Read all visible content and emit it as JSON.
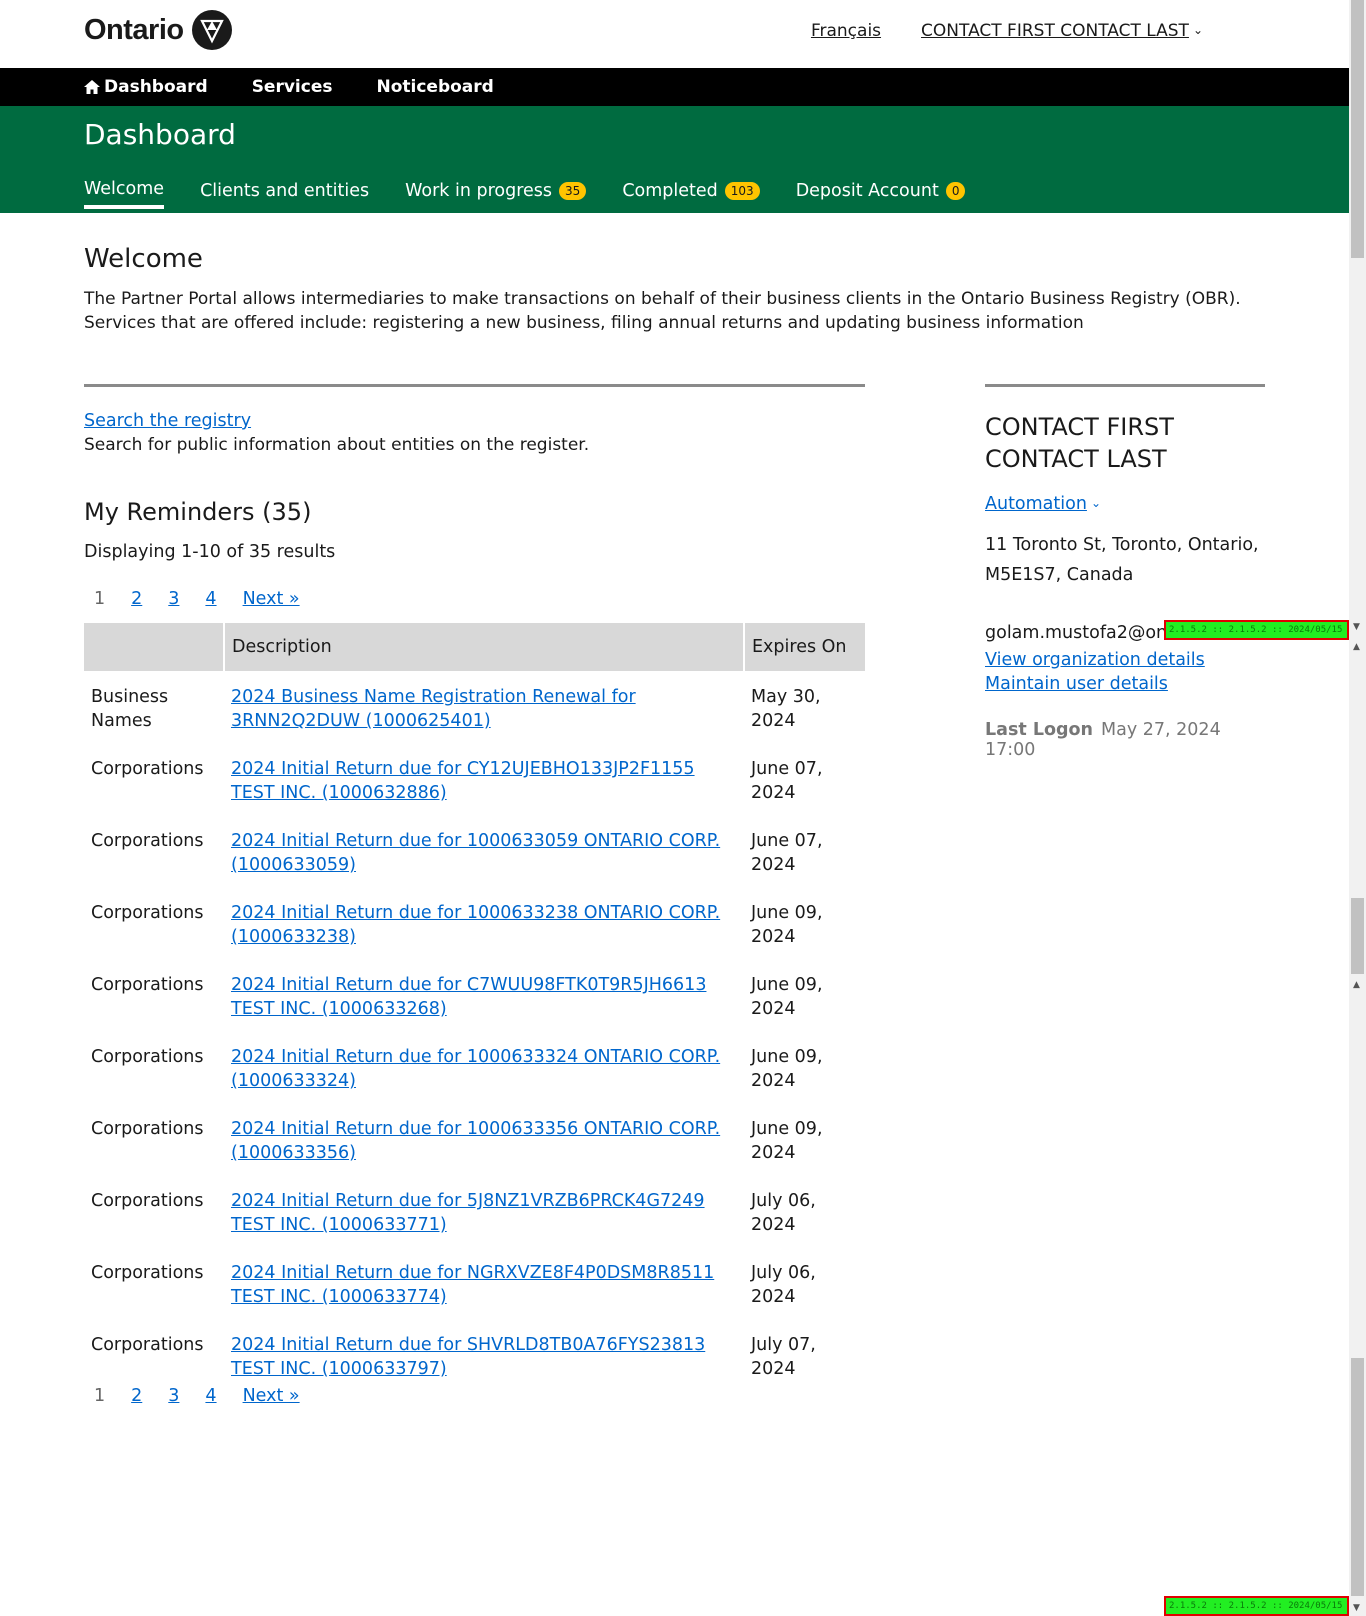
{
  "header": {
    "logo_text": "Ontario",
    "language_link": "Français",
    "user_menu": "CONTACT FIRST CONTACT LAST"
  },
  "topnav": {
    "items": [
      {
        "label": "Dashboard",
        "icon": "home-icon"
      },
      {
        "label": "Services"
      },
      {
        "label": "Noticeboard"
      }
    ]
  },
  "band": {
    "title": "Dashboard",
    "tabs": [
      {
        "label": "Welcome",
        "active": true
      },
      {
        "label": "Clients and entities"
      },
      {
        "label": "Work in progress",
        "badge": "35"
      },
      {
        "label": "Completed",
        "badge": "103"
      },
      {
        "label": "Deposit Account",
        "badge": "0"
      }
    ]
  },
  "welcome": {
    "heading": "Welcome",
    "intro": "The Partner Portal allows intermediaries to make transactions on behalf of their business clients in the Ontario Business Registry (OBR). Services that are offered include: registering a new business, filing annual returns and updating business information"
  },
  "search": {
    "link": "Search the registry",
    "desc": "Search for public information about entities on the register."
  },
  "reminders": {
    "heading": "My Reminders (35)",
    "count_text": "Displaying 1-10 of 35 results",
    "pager": {
      "current": "1",
      "pages": [
        "2",
        "3",
        "4"
      ],
      "next": "Next »"
    },
    "columns": [
      "",
      "Description",
      "Expires On"
    ],
    "rows": [
      {
        "type": "Business Names",
        "desc": "2024 Business Name Registration Renewal for 3RNN2Q2DUW (1000625401)",
        "expires": "May 30, 2024"
      },
      {
        "type": "Corporations",
        "desc": "2024 Initial Return due for CY12UJEBHO133JP2F1155 TEST INC. (1000632886)",
        "expires": "June 07, 2024"
      },
      {
        "type": "Corporations",
        "desc": "2024 Initial Return due for 1000633059 ONTARIO CORP. (1000633059)",
        "expires": "June 07, 2024"
      },
      {
        "type": "Corporations",
        "desc": "2024 Initial Return due for 1000633238 ONTARIO CORP. (1000633238)",
        "expires": "June 09, 2024"
      },
      {
        "type": "Corporations",
        "desc": "2024 Initial Return due for C7WUU98FTK0T9R5JH6613 TEST INC. (1000633268)",
        "expires": "June 09, 2024"
      },
      {
        "type": "Corporations",
        "desc": "2024 Initial Return due for 1000633324 ONTARIO CORP. (1000633324)",
        "expires": "June 09, 2024"
      },
      {
        "type": "Corporations",
        "desc": "2024 Initial Return due for 1000633356 ONTARIO CORP. (1000633356)",
        "expires": "June 09, 2024"
      },
      {
        "type": "Corporations",
        "desc": "2024 Initial Return due for 5J8NZ1VRZB6PRCK4G7249 TEST INC. (1000633771)",
        "expires": "July 06, 2024"
      },
      {
        "type": "Corporations",
        "desc": "2024 Initial Return due for NGRXVZE8F4P0DSM8R8511 TEST INC. (1000633774)",
        "expires": "July 06, 2024"
      },
      {
        "type": "Corporations",
        "desc": "2024 Initial Return due for SHVRLD8TB0A76FYS23813 TEST INC. (1000633797)",
        "expires": "July 07, 2024"
      }
    ]
  },
  "profile": {
    "name": "CONTACT FIRST CONTACT LAST",
    "org": "Automation",
    "address": "11 Toronto St, Toronto, Ontario, M5E1S7, Canada",
    "email": "golam.mustofa2@ontario.ca",
    "view_org": "View organization details",
    "maintain": "Maintain user details",
    "last_logon_label": "Last Logon",
    "last_logon_value": "May 27, 2024 17:00"
  },
  "version_tags": {
    "mid": "2.1.5.2 :: 2.1.5.2 :: 2024/05/15 10:15",
    "bottom": "2.1.5.2 :: 2.1.5.2 :: 2024/05/15 10:15"
  },
  "colors": {
    "green": "#006b40",
    "black": "#000000",
    "badge": "#ffc400",
    "link": "#0066cc"
  }
}
